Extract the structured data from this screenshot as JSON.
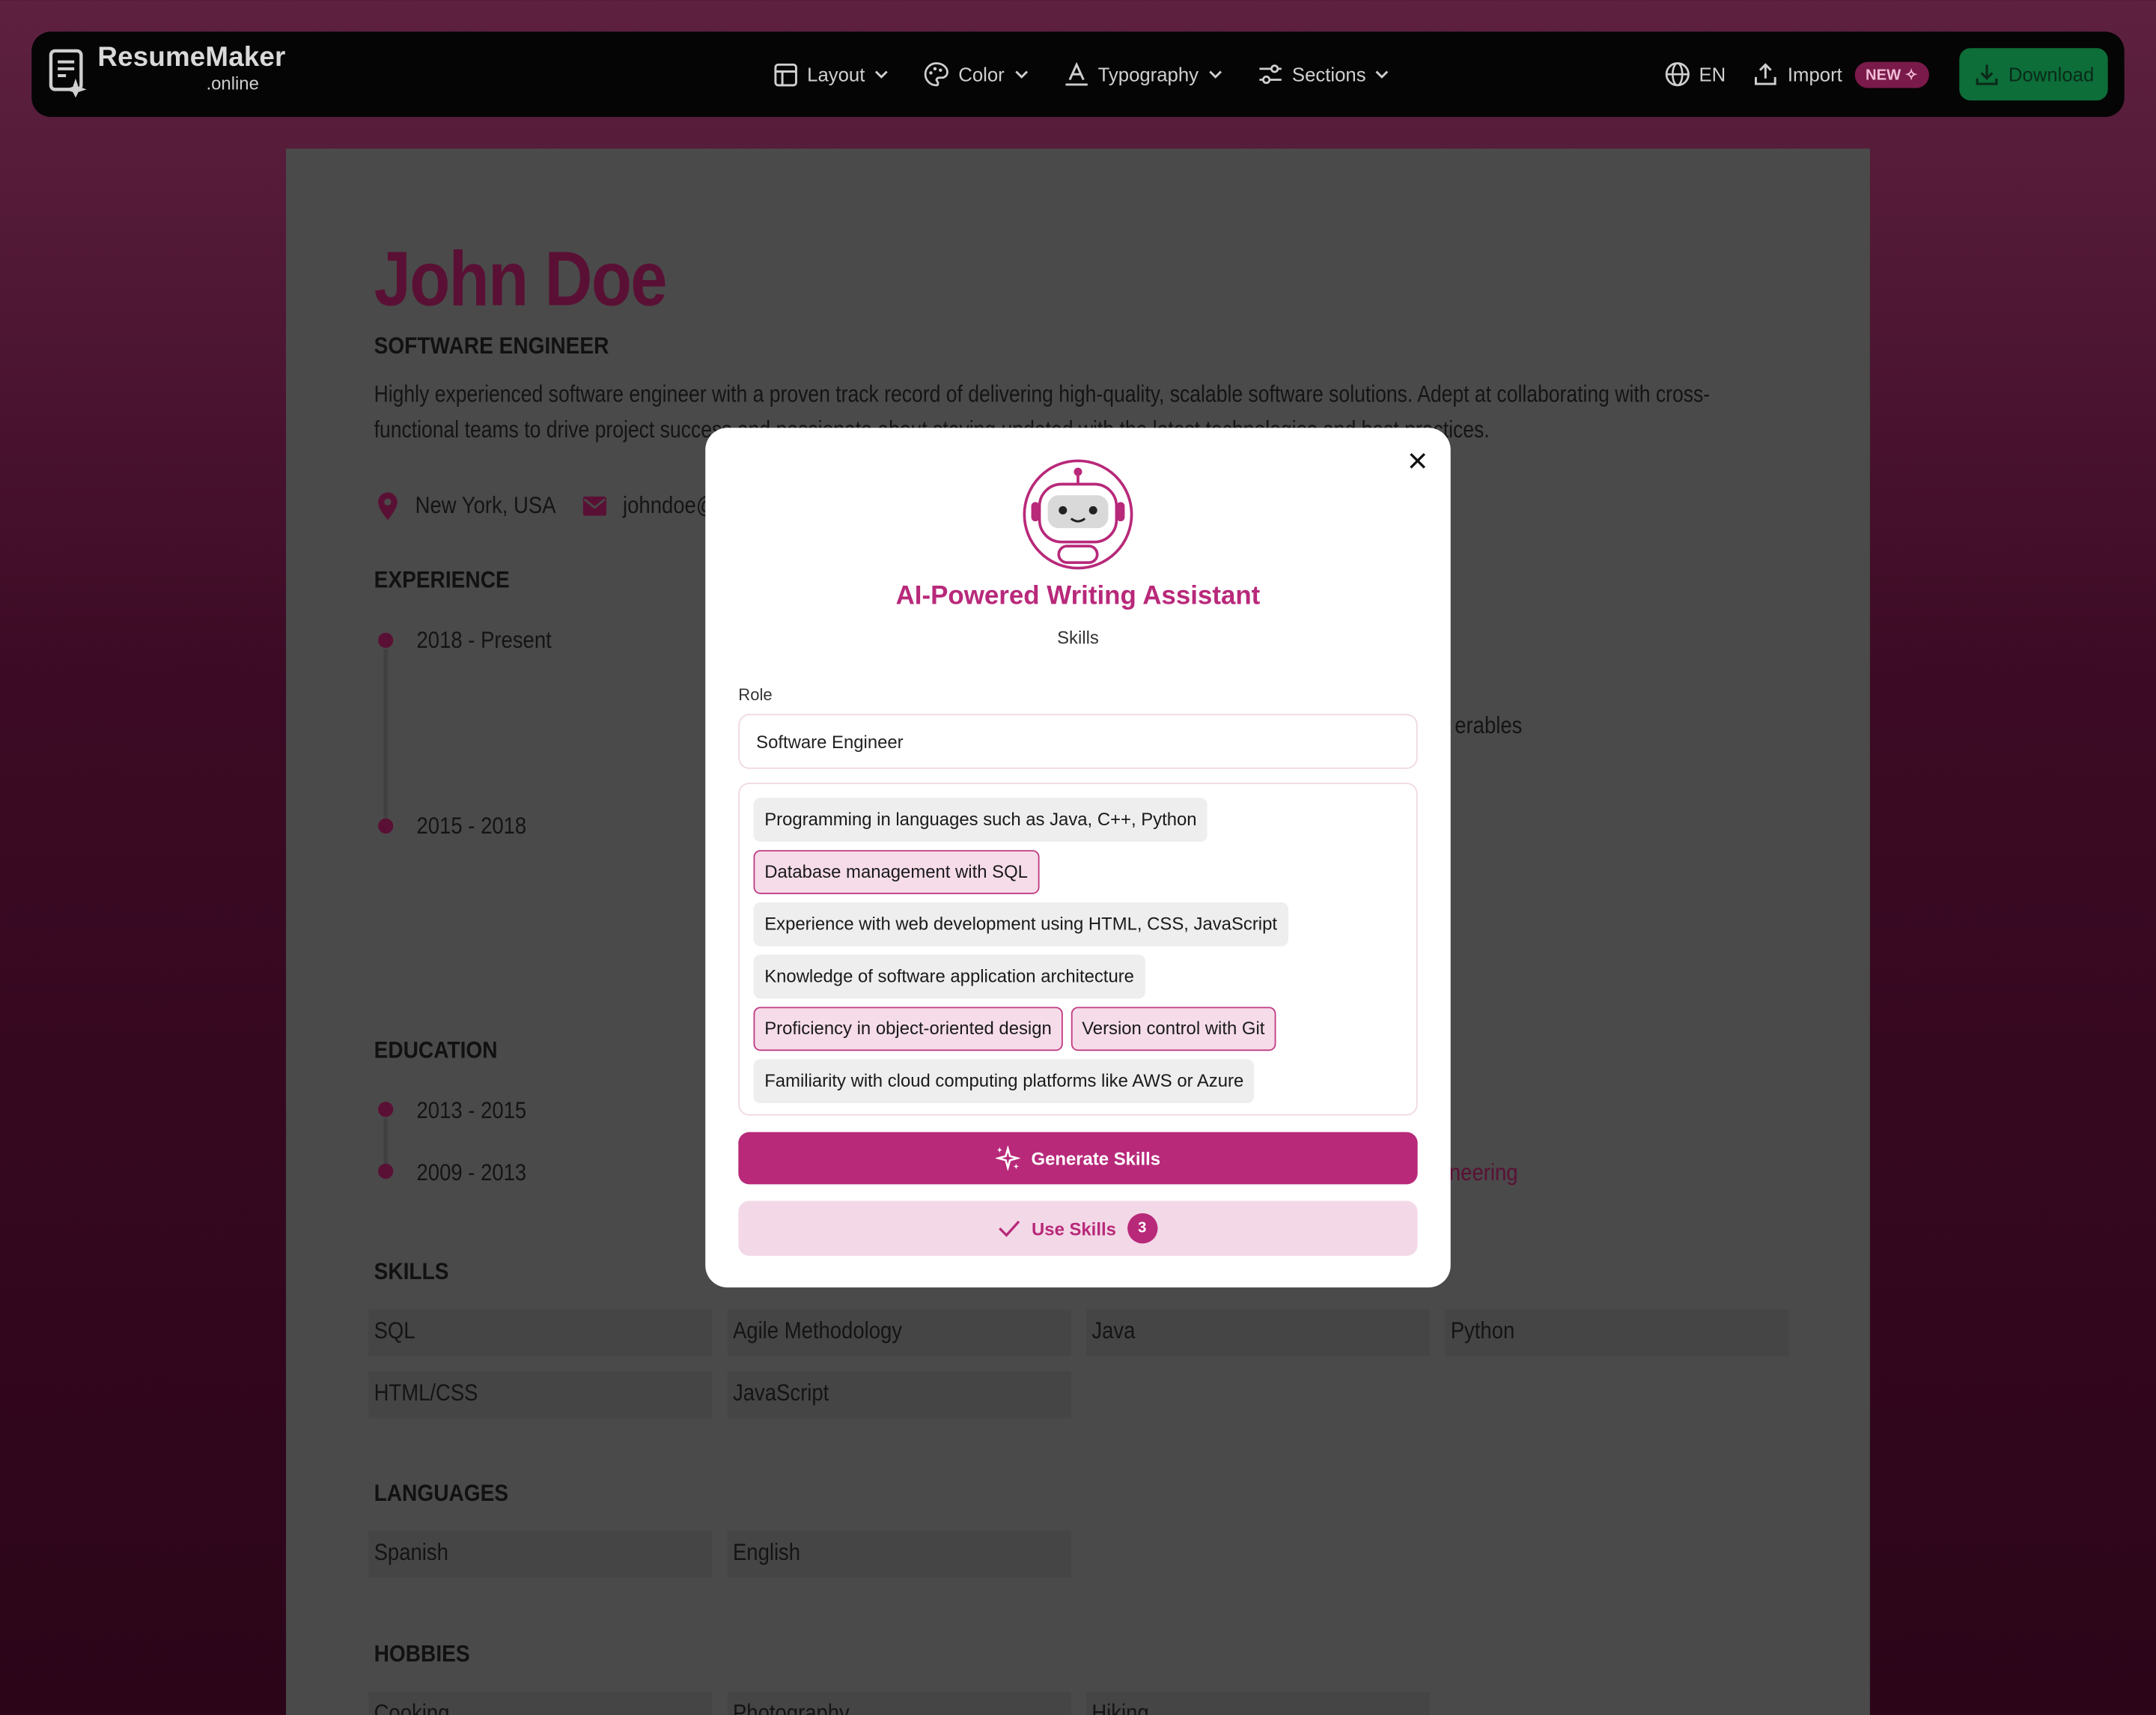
{
  "app": {
    "logo_main": "ResumeMaker",
    "logo_sub": ".online",
    "nav": [
      {
        "label": "Layout",
        "icon": "layout-icon"
      },
      {
        "label": "Color",
        "icon": "palette-icon"
      },
      {
        "label": "Typography",
        "icon": "typography-icon"
      },
      {
        "label": "Sections",
        "icon": "sections-icon"
      }
    ],
    "language": "EN",
    "import_label": "Import",
    "new_badge": "NEW ✧",
    "download_label": "Download"
  },
  "resume": {
    "name": "John Doe",
    "title": "SOFTWARE ENGINEER",
    "summary": "Highly experienced software engineer with a proven track record of delivering high-quality, scalable software solutions. Adept at collaborating with cross-functional teams to drive project success and passionate about staying updated with the latest technologies and best practices.",
    "location": "New York, USA",
    "email": "johndoe@",
    "sections": {
      "experience": "EXPERIENCE",
      "education": "EDUCATION",
      "skills": "SKILLS",
      "languages": "LANGUAGES",
      "hobbies": "HOBBIES"
    },
    "experience_dates": [
      "2018 - Present",
      "2015 - 2018"
    ],
    "experience_fragment": "erables",
    "education_dates": [
      "2013 - 2015",
      "2009 - 2013"
    ],
    "education_fragment": "neering",
    "skills": [
      "SQL",
      "Agile Methodology",
      "Java",
      "Python",
      "HTML/CSS",
      "JavaScript"
    ],
    "languages": [
      "Spanish",
      "English"
    ],
    "hobbies": [
      "Cooking",
      "Photography",
      "Hiking"
    ]
  },
  "modal": {
    "title": "AI-Powered Writing Assistant",
    "subtitle": "Skills",
    "role_label": "Role",
    "role_value": "Software Engineer",
    "suggestions": [
      {
        "text": "Programming in languages such as Java, C++, Python",
        "selected": false
      },
      {
        "text": "Database management with SQL",
        "selected": true
      },
      {
        "text": "Experience with web development using HTML, CSS, JavaScript",
        "selected": false
      },
      {
        "text": "Knowledge of software application architecture",
        "selected": false
      },
      {
        "text": "Proficiency in object-oriented design",
        "selected": true
      },
      {
        "text": "Version control with Git",
        "selected": true
      },
      {
        "text": "Familiarity with cloud computing platforms like AWS or Azure",
        "selected": false
      }
    ],
    "generate_label": "Generate Skills",
    "use_label": "Use Skills",
    "use_count": "3"
  },
  "colors": {
    "accent": "#b8297a",
    "download_green": "#0d6e3a"
  }
}
